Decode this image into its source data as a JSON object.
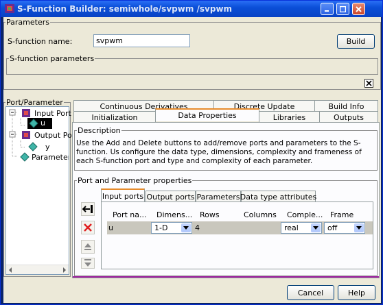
{
  "window": {
    "title": "S-Function Builder: semiwhole/svpwm   /svpwm"
  },
  "parameters": {
    "group_label": "Parameters",
    "name_label": "S-function name:",
    "name_value": "svpwm",
    "build_label": "Build",
    "sfun_params_label": "S-function parameters"
  },
  "port_parameter": {
    "label": "Port/Parameter",
    "tree": [
      "Input Port",
      "u",
      "Output Po",
      "y",
      "Parameters"
    ]
  },
  "tabs": {
    "row1": [
      "Continuous Derivatives",
      "Discrete Update",
      "Build Info"
    ],
    "row2": [
      "Initialization",
      "Data Properties",
      "Libraries",
      "Outputs"
    ],
    "active": "Data Properties"
  },
  "description": {
    "label": "Description",
    "text": "Use the Add and Delete buttons to add/remove ports and parameters to the S-function. Us configure the data type, dimensions, complexity and frameness of each S-function port and type and complexity of each parameter."
  },
  "port_props": {
    "label": "Port and Parameter properties",
    "tabs": [
      "Input ports",
      "Output ports",
      "Parameters",
      "Data type attributes"
    ],
    "active_tab": "Input ports",
    "columns": [
      "Port na...",
      "Dimens...",
      "Rows",
      "Columns",
      "Comple...",
      "Frame"
    ],
    "rows": [
      {
        "port_name": "u",
        "dimensions": "1-D",
        "rows": "4",
        "columns": "",
        "complexity": "real",
        "frame": "off"
      }
    ]
  },
  "footer": {
    "cancel_label": "Cancel",
    "help_label": "Help"
  }
}
